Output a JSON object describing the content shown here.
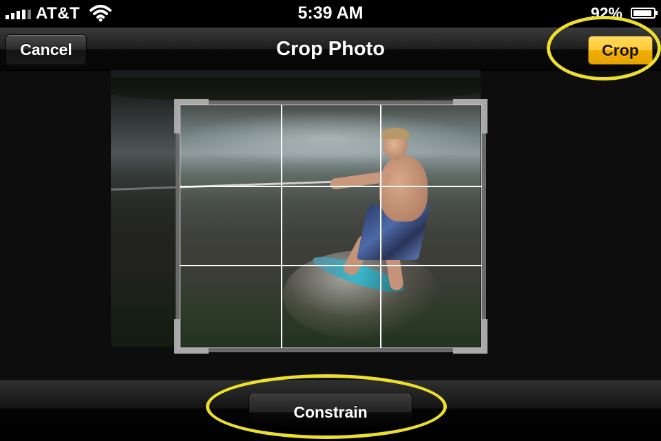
{
  "status_bar": {
    "carrier": "AT&T",
    "time": "5:39 AM",
    "battery_text": "92%",
    "battery_level": 0.92,
    "signal_bars": 4
  },
  "nav": {
    "title": "Crop Photo",
    "cancel_label": "Cancel",
    "crop_label": "Crop"
  },
  "toolbar": {
    "constrain_label": "Constrain"
  },
  "colors": {
    "accent_button": "#ffc93a",
    "annotation_highlight": "#ecdf2e",
    "background": "#0d0d0d"
  },
  "icons": [
    "signal-bars-icon",
    "wifi-icon",
    "battery-icon"
  ]
}
